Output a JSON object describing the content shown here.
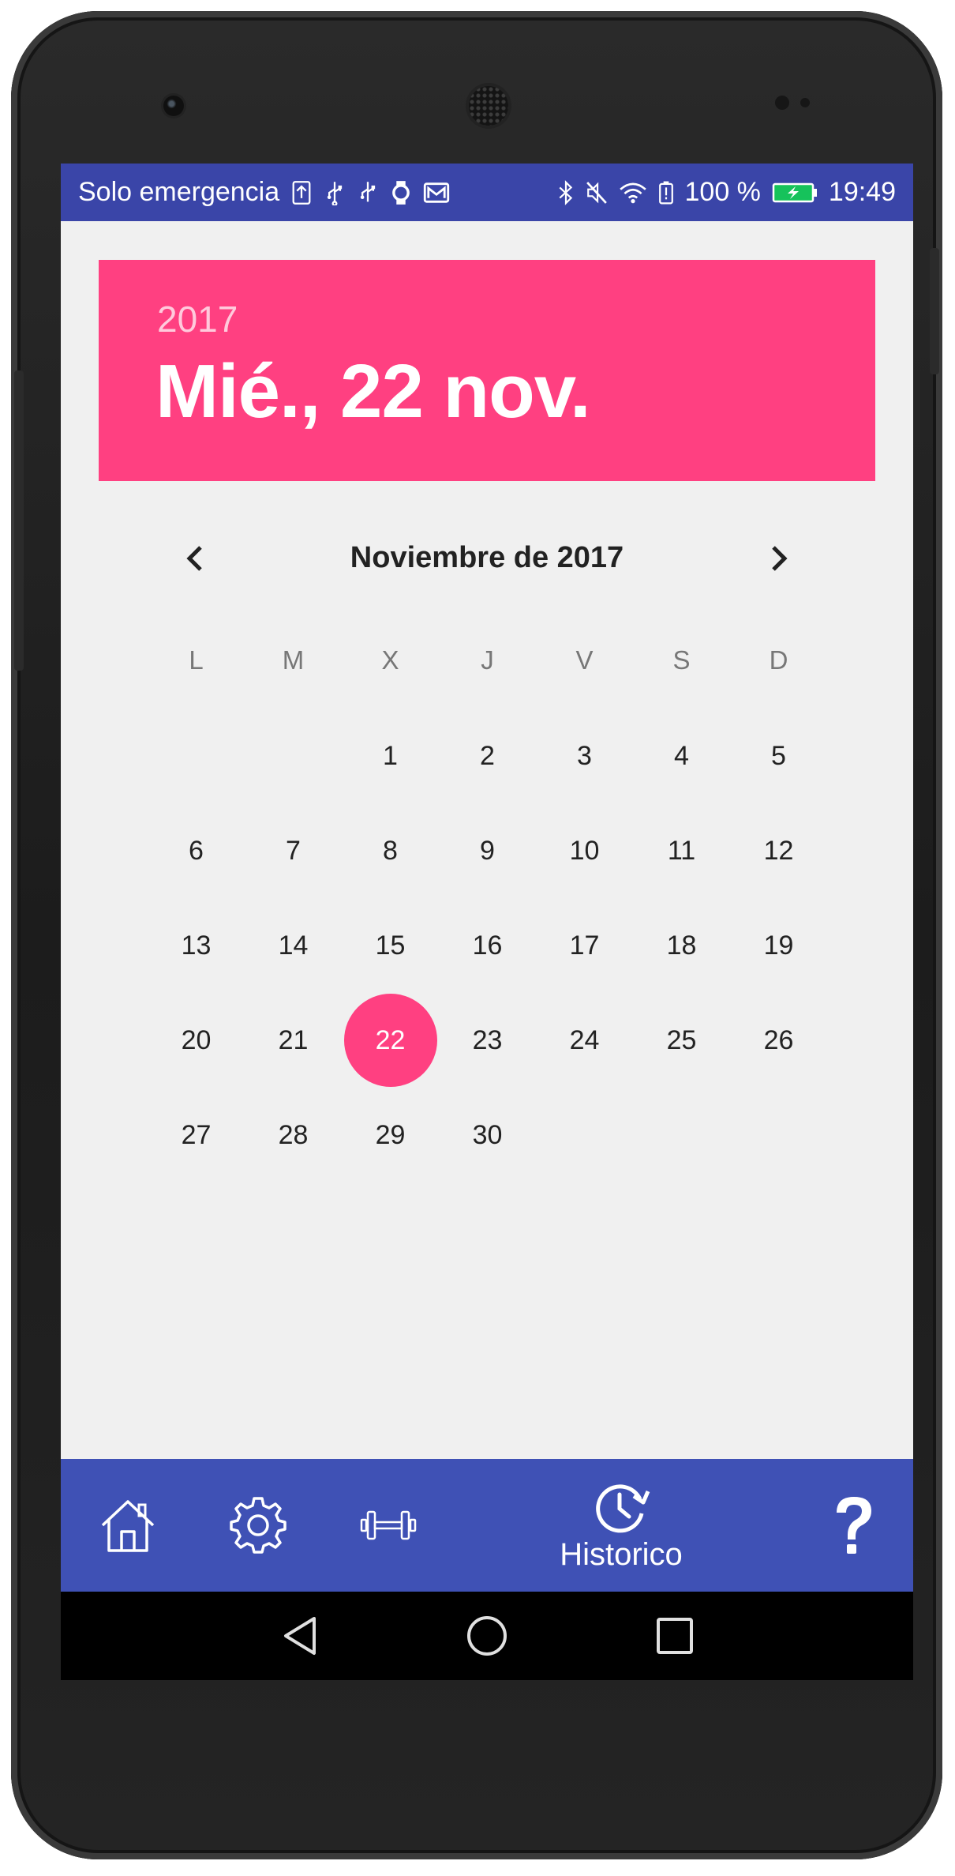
{
  "status_bar": {
    "carrier": "Solo emergencia",
    "battery": "100 %",
    "time": "19:49",
    "icons_left": [
      "upload-icon",
      "usb-icon",
      "usb-icon",
      "watch-icon",
      "mail-icon"
    ],
    "icons_right": [
      "bluetooth-icon",
      "mute-icon",
      "wifi-icon",
      "battery-alert-icon",
      "battery-charging-icon"
    ]
  },
  "header": {
    "year": "2017",
    "date": "Mié., 22 nov."
  },
  "calendar": {
    "month_title": "Noviembre de 2017",
    "prev_icon": "chevron-left-icon",
    "next_icon": "chevron-right-icon",
    "weekdays": [
      "L",
      "M",
      "X",
      "J",
      "V",
      "S",
      "D"
    ],
    "days": [
      "",
      "",
      "1",
      "2",
      "3",
      "4",
      "5",
      "6",
      "7",
      "8",
      "9",
      "10",
      "11",
      "12",
      "13",
      "14",
      "15",
      "16",
      "17",
      "18",
      "19",
      "20",
      "21",
      "22",
      "23",
      "24",
      "25",
      "26",
      "27",
      "28",
      "29",
      "30",
      "",
      "",
      ""
    ],
    "selected_day": "22",
    "accent_color": "#ff4081"
  },
  "bottom_nav": {
    "items": [
      {
        "icon": "home-icon",
        "label": ""
      },
      {
        "icon": "gear-icon",
        "label": ""
      },
      {
        "icon": "dumbbell-icon",
        "label": ""
      },
      {
        "icon": "history-icon",
        "label": "Historico"
      },
      {
        "icon": "help-icon",
        "label": ""
      }
    ],
    "background": "#3f51b5"
  },
  "system_nav": {
    "buttons": [
      "back-icon",
      "home-circle-icon",
      "recents-icon"
    ]
  }
}
